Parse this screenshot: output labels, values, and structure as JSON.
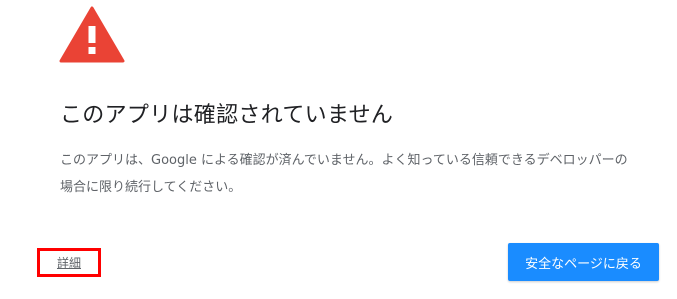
{
  "warning": {
    "icon": "warning-triangle-icon",
    "color": "#ea4335"
  },
  "title": "このアプリは確認されていません",
  "description": "このアプリは、Google による確認が済んでいません。よく知っている信頼できるデベロッパーの場合に限り続行してください。",
  "details_link": "詳細",
  "back_button": {
    "label": "安全なページに戻る",
    "color": "#1a8cff"
  },
  "highlight_color": "#ff0000"
}
